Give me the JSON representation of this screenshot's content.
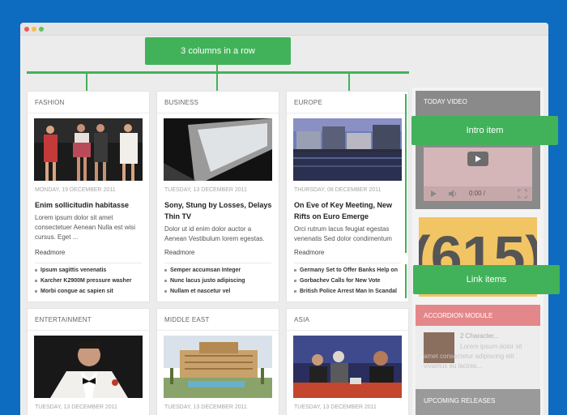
{
  "annotations": {
    "columns": "3 columns in a row",
    "intro_item": "Intro item",
    "link_items": "Link items"
  },
  "cards": [
    {
      "category": "FASHION",
      "date": "MONDAY, 19 DECEMBER 2011",
      "title": "Enim sollicitudin habitasse",
      "intro": "Lorem ipsum dolor sit amet consectetuer Aenean Nulla est wisi cursus. Eget ...",
      "more": "Readmore",
      "links": [
        "Ipsum sagittis venenatis",
        "Karcher K2900M pressure washer",
        "Morbi congue ac sapien sit"
      ]
    },
    {
      "category": "BUSINESS",
      "date": "TUESDAY, 13 DECEMBER 2011",
      "title": "Sony, Stung by Losses, Delays Thin TV",
      "intro": "Dolor ut id enim dolor auctor a Aenean Vestibulum lorem egestas.",
      "more": "Readmore",
      "links": [
        "Semper accumsan Integer",
        "Nunc lacus justo adipiscing",
        "Nullam et nascetur vel"
      ]
    },
    {
      "category": "EUROPE",
      "date": "THURSDAY, 08 DECEMBER 2011",
      "title": "On Eve of Key Meeting, New Rifts on Euro Emerge",
      "intro": "Orci rutrum lacus feugiat egestas venenatis Sed dolor condimentum",
      "more": "Readmore",
      "links": [
        "Germany Set to Offer Banks Help on",
        "Gorbachev Calls for New Vote",
        "British Police Arrest Man In Scandal"
      ]
    },
    {
      "category": "ENTERTAINMENT",
      "date": "TUESDAY, 13 DECEMBER 2011"
    },
    {
      "category": "MIDDLE EAST",
      "date": "TUESDAY, 13 DECEMBER 2011"
    },
    {
      "category": "ASIA",
      "date": "TUESDAY, 13 DECEMBER 2011"
    }
  ],
  "sidebar": {
    "today_video": "TODAY VIDEO",
    "video_time": "0:00 /",
    "logo_text": "(615)",
    "accordion": "ACCORDION MODULE",
    "accordion_item_title": "2 Character...",
    "accordion_item_text": "Lorem ipsum dolor sit amet consectetur adipiscing elit vivamus eu lacinia...",
    "upcoming": "UPCOMING RELEASES"
  }
}
